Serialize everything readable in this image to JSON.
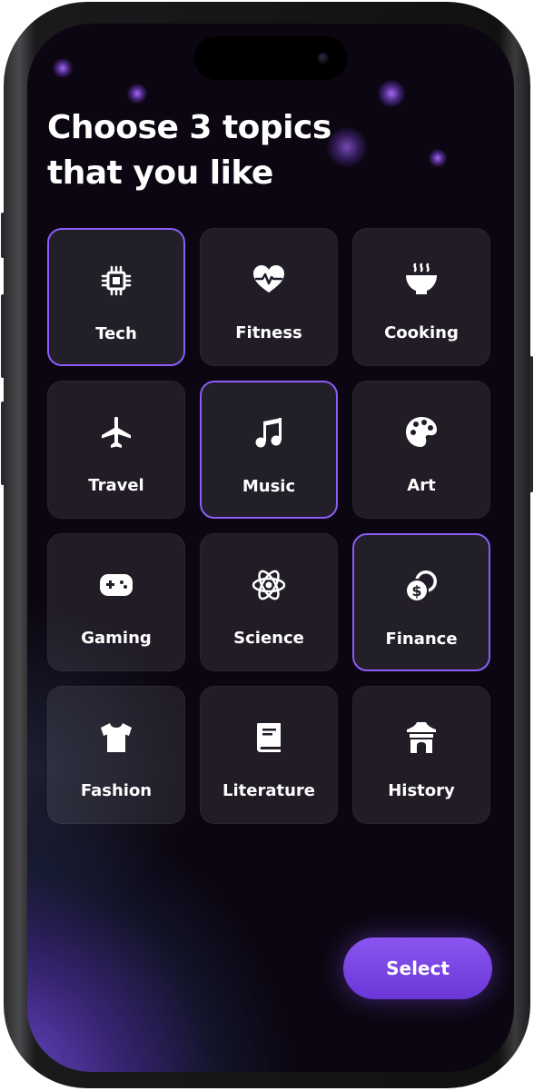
{
  "title": "Choose 3 topics\nthat you like",
  "topics": [
    {
      "label": "Tech",
      "icon": "chip-icon",
      "selected": true
    },
    {
      "label": "Fitness",
      "icon": "heart-pulse-icon",
      "selected": false
    },
    {
      "label": "Cooking",
      "icon": "bowl-steam-icon",
      "selected": false
    },
    {
      "label": "Travel",
      "icon": "airplane-icon",
      "selected": false
    },
    {
      "label": "Music",
      "icon": "music-note-icon",
      "selected": true
    },
    {
      "label": "Art",
      "icon": "palette-icon",
      "selected": false
    },
    {
      "label": "Gaming",
      "icon": "gamepad-icon",
      "selected": false
    },
    {
      "label": "Science",
      "icon": "atom-icon",
      "selected": false
    },
    {
      "label": "Finance",
      "icon": "coins-icon",
      "selected": true
    },
    {
      "label": "Fashion",
      "icon": "tshirt-icon",
      "selected": false
    },
    {
      "label": "Literature",
      "icon": "book-icon",
      "selected": false
    },
    {
      "label": "History",
      "icon": "temple-icon",
      "selected": false
    }
  ],
  "select_button": {
    "label": "Select"
  },
  "colors": {
    "background": "#0b0611",
    "card": "#221c2a",
    "accent": "#8b5cf6",
    "button": "#7c44e8",
    "text": "#ffffff"
  }
}
